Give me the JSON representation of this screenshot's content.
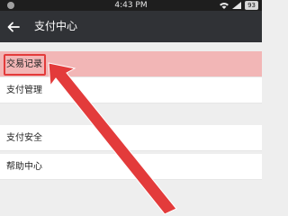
{
  "status_bar": {
    "time": "4:43 PM",
    "battery": "93"
  },
  "app_bar": {
    "title": "支付中心"
  },
  "menu": {
    "items": [
      {
        "label": "交易记录"
      },
      {
        "label": "支付管理"
      },
      {
        "label": "支付安全"
      },
      {
        "label": "帮助中心"
      }
    ]
  },
  "colors": {
    "highlight": "#f2b6b6",
    "annotation": "#e33b3b",
    "app_bar": "#303236"
  },
  "icons": {
    "back": "arrow-left-icon",
    "wifi": "wifi-icon",
    "signal": "signal-icon",
    "battery": "battery-icon"
  }
}
